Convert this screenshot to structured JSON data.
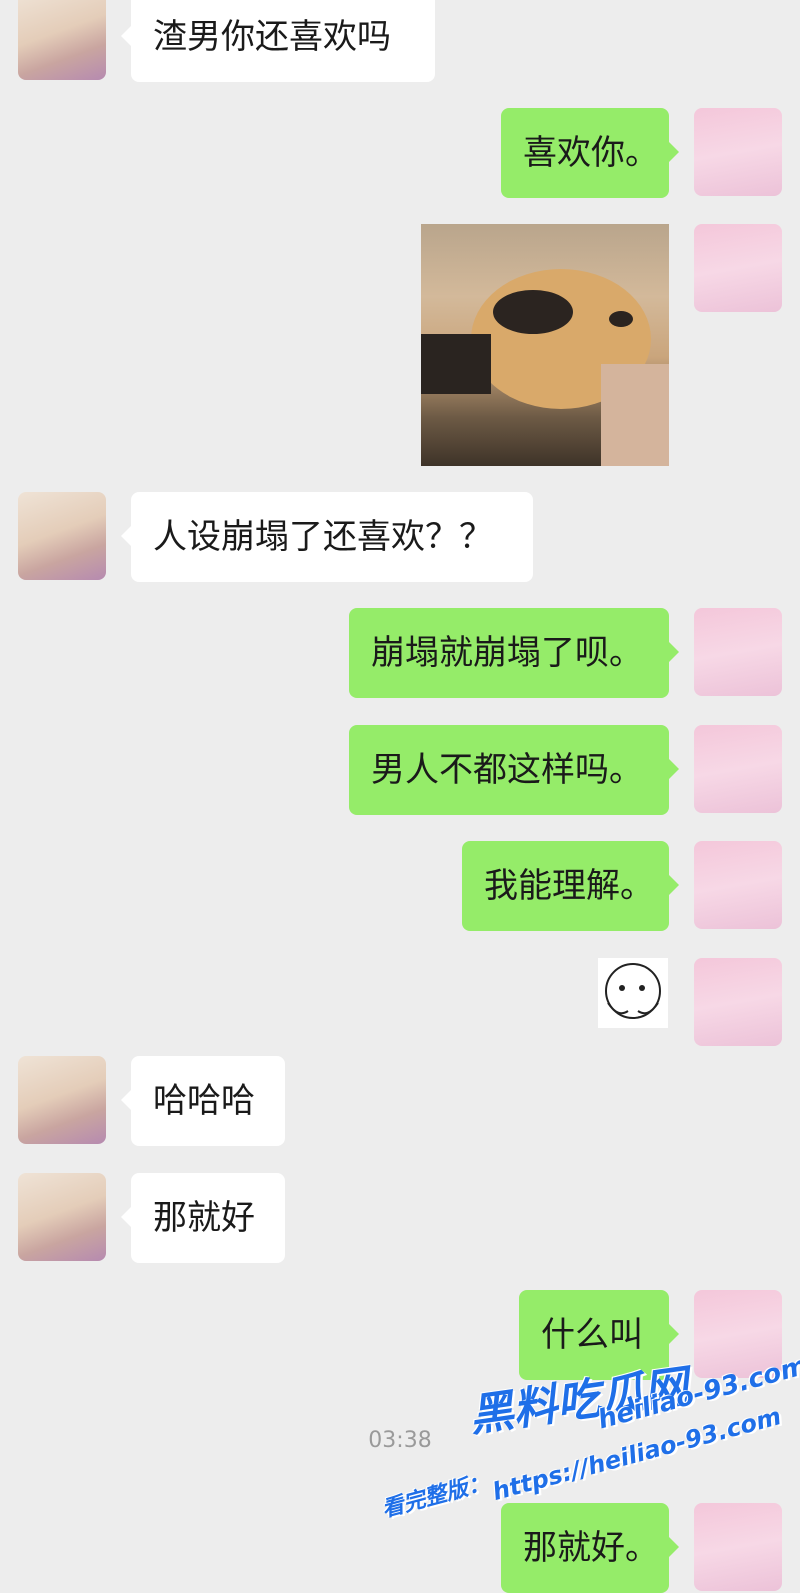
{
  "messages": [
    {
      "side": "left",
      "text": "渣男你还喜欢吗"
    },
    {
      "side": "right",
      "text": "喜欢你。"
    },
    {
      "side": "right",
      "type": "image",
      "alt": ""
    },
    {
      "side": "left",
      "text": "人设崩塌了还喜欢？？"
    },
    {
      "side": "right",
      "text": "崩塌就崩塌了呗。"
    },
    {
      "side": "right",
      "text": "男人不都这样吗。"
    },
    {
      "side": "right",
      "text": "我能理解。"
    },
    {
      "side": "right",
      "type": "sticker"
    },
    {
      "side": "left",
      "text": "哈哈哈"
    },
    {
      "side": "left",
      "text": "那就好"
    },
    {
      "side": "right",
      "text": "什么叫"
    },
    {
      "side": "right",
      "text": "那就好。"
    }
  ],
  "timestamp": "03:38",
  "watermark": {
    "brand": "黑料吃瓜网",
    "domain": "heiliao-93.com",
    "full_label": "看完整版：",
    "full_url": "https://heiliao-93.com"
  },
  "colors": {
    "background": "#ededed",
    "green_bubble": "#95ec69",
    "white_bubble": "#ffffff",
    "watermark": "#1f6fe8"
  }
}
